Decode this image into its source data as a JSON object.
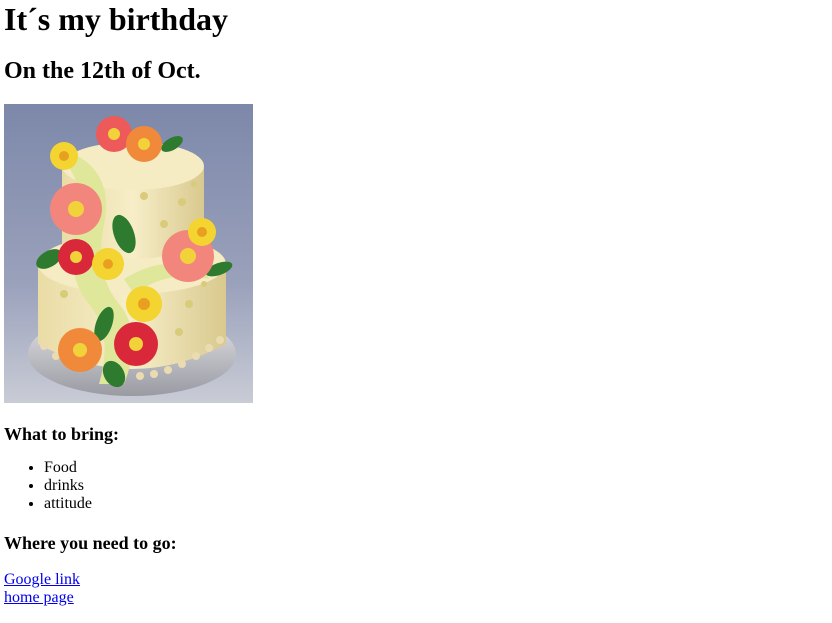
{
  "title": "It´s my birthday",
  "subtitle": "On the 12th of Oct.",
  "image": {
    "subject": "two-tier-cake-with-flowers",
    "bg": "#8a93b0",
    "cake": "#f3e7b8",
    "drape": "#dfe79a"
  },
  "bring": {
    "heading": "What to bring:",
    "items": [
      "Food",
      "drinks",
      "attitude"
    ]
  },
  "where": {
    "heading": "Where you need to go:",
    "links": [
      "Google link",
      "home page"
    ]
  },
  "colors": {
    "link": "#0000ee",
    "text": "#000000"
  }
}
